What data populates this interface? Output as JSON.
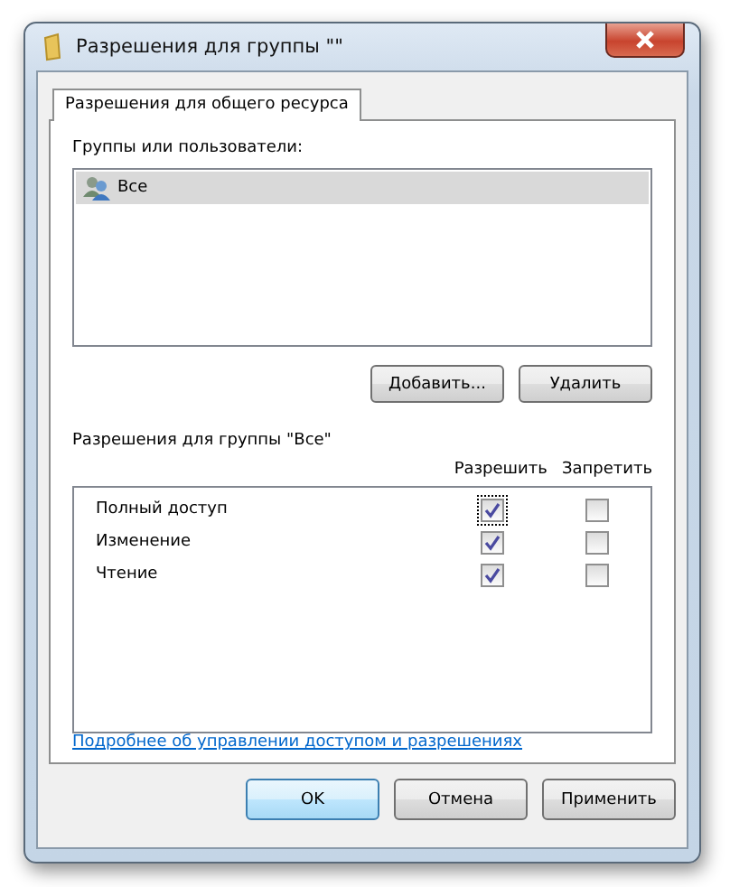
{
  "window": {
    "title": "Разрешения для группы \"\""
  },
  "tabs": [
    {
      "label": "Разрешения для общего ресурса",
      "selected": true
    }
  ],
  "users": {
    "label": "Группы или пользователи:",
    "items": [
      {
        "name": "Все",
        "selected": true
      }
    ]
  },
  "user_buttons": [
    "Добавить...",
    "Удалить"
  ],
  "permissions": {
    "label": "Разрешения для группы \"Все\"",
    "columns": [
      "Разрешить",
      "Запретить"
    ],
    "rows": [
      {
        "name": "Полный доступ",
        "allow": true,
        "deny": false,
        "focused": true
      },
      {
        "name": "Изменение",
        "allow": true,
        "deny": false,
        "focused": false
      },
      {
        "name": "Чтение",
        "allow": true,
        "deny": false,
        "focused": false
      }
    ]
  },
  "link": "Подробнее об управлении доступом и разрешениях",
  "buttons": [
    {
      "label": "OK",
      "default": true
    },
    {
      "label": "Отмена",
      "default": false
    },
    {
      "label": "Применить",
      "default": false
    }
  ]
}
